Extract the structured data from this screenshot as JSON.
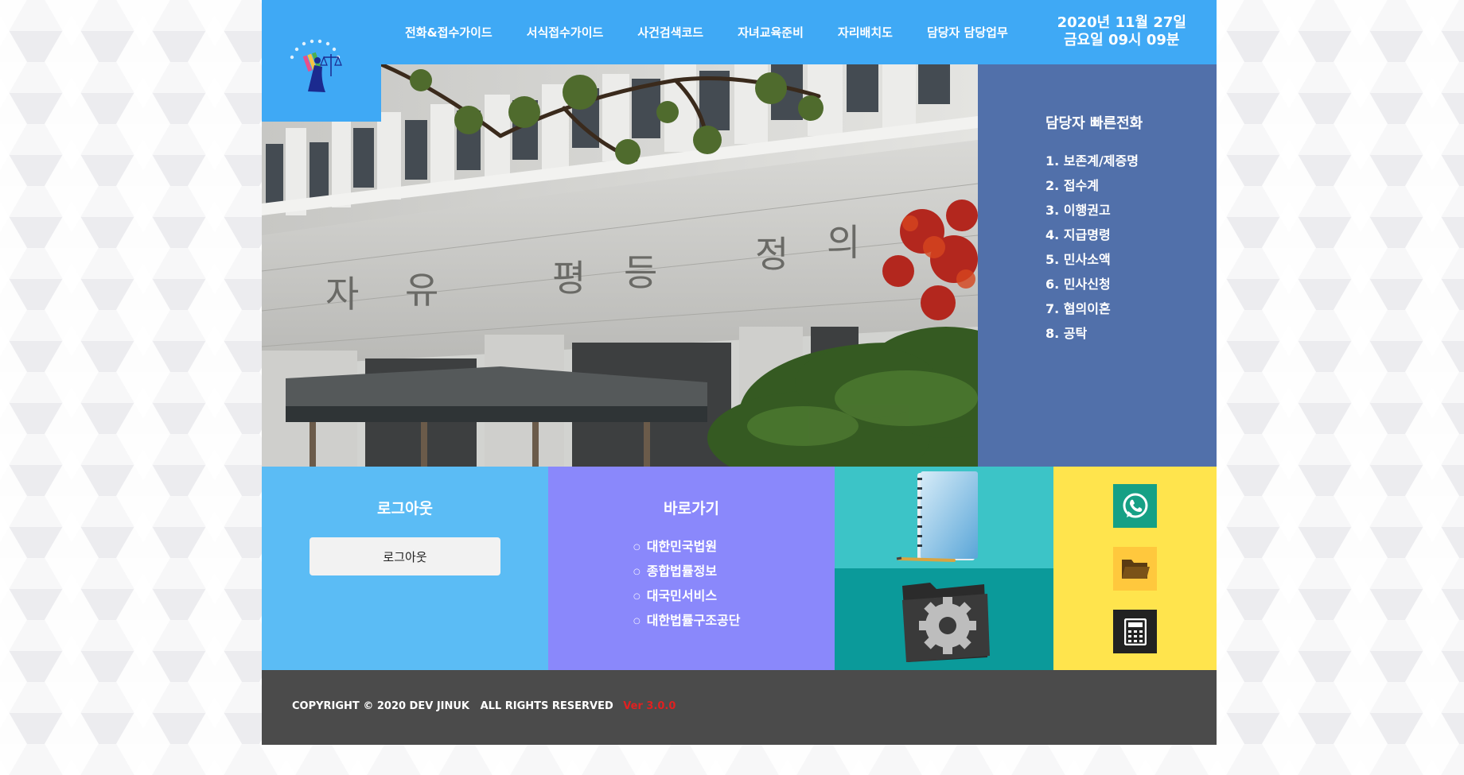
{
  "logo": {
    "alt": "대한민국법원"
  },
  "nav": {
    "items": [
      {
        "label": "전화&접수가이드"
      },
      {
        "label": "서식접수가이드"
      },
      {
        "label": "사건검색코드"
      },
      {
        "label": "자녀교육준비"
      },
      {
        "label": "자리배치도"
      },
      {
        "label": "담당자 담당업무"
      }
    ]
  },
  "clock": {
    "date": "2020년 11월 27일",
    "time": "금요일 09시 09분"
  },
  "hero": {
    "engraving": [
      "자",
      "유",
      "평",
      "등",
      "정",
      "의"
    ]
  },
  "quick_call": {
    "title": "담당자 빠른전화",
    "items": [
      {
        "label": "1. 보존계/제증명"
      },
      {
        "label": "2. 접수계"
      },
      {
        "label": "3. 이행권고"
      },
      {
        "label": "4. 지급명령"
      },
      {
        "label": "5. 민사소액"
      },
      {
        "label": "6. 민사신청"
      },
      {
        "label": "7. 협의이혼"
      },
      {
        "label": "8. 공탁"
      }
    ]
  },
  "logout_tile": {
    "title": "로그아웃",
    "button_label": "로그아웃"
  },
  "links_tile": {
    "title": "바로가기",
    "items": [
      {
        "label": "대한민국법원"
      },
      {
        "label": "종합법률정보"
      },
      {
        "label": "대국민서비스"
      },
      {
        "label": "대한법률구조공단"
      }
    ]
  },
  "side_icons": [
    {
      "icon": "whatsapp-icon",
      "color": "#16a085"
    },
    {
      "icon": "folder-icon",
      "color": "#ffc83d"
    },
    {
      "icon": "calculator-icon",
      "color": "#222222"
    }
  ],
  "footer": {
    "copyright": "COPYRIGHT © 2020 DEV JINUK   ALL RIGHTS RESERVED",
    "version": "Ver 3.0.0"
  },
  "colors": {
    "header": "#3fa9f5",
    "quick_panel": "#5170aa",
    "logout_tile": "#5bbcf5",
    "links_tile": "#8a88fb",
    "book_tile": "#3cc4c7",
    "settings_tile": "#0b9a9a",
    "icons_tile": "#ffe44d",
    "footer": "#4b4b4b",
    "version_text": "#e02020"
  }
}
